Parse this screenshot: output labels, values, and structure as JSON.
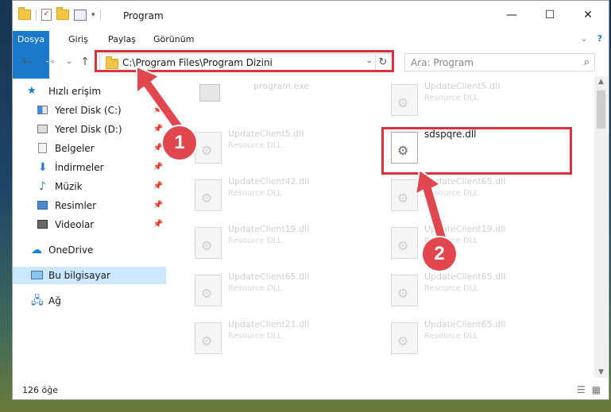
{
  "window": {
    "title": "Program",
    "controls": {
      "minimize": "—",
      "maximize": "☐",
      "close": "✕"
    }
  },
  "ribbon": {
    "tabs": [
      "Dosya",
      "Giriş",
      "Paylaş",
      "Görünüm"
    ],
    "expand": "⌄",
    "help": "?"
  },
  "nav": {
    "back": "←",
    "forward": "→",
    "recent": "⌄",
    "up": "↑"
  },
  "address": {
    "path": "C:\\Program Files\\Program Dizini",
    "dropdown": "⌄",
    "refresh": "↻"
  },
  "search": {
    "placeholder": "Ara: Program",
    "icon": "⌕"
  },
  "sidebar": {
    "items": [
      {
        "label": "Hızlı erişim",
        "icon": "star-icon",
        "pinned": false
      },
      {
        "label": "Yerel Disk (C:)",
        "icon": "drive-icon",
        "pinned": true
      },
      {
        "label": "Yerel Disk (D:)",
        "icon": "drive-icon",
        "pinned": true
      },
      {
        "label": "Belgeler",
        "icon": "document-icon",
        "pinned": true
      },
      {
        "label": "İndirmeler",
        "icon": "download-icon",
        "pinned": true
      },
      {
        "label": "Müzik",
        "icon": "music-icon",
        "pinned": true
      },
      {
        "label": "Resimler",
        "icon": "pictures-icon",
        "pinned": true
      },
      {
        "label": "Videolar",
        "icon": "video-icon",
        "pinned": true
      },
      {
        "label": "OneDrive",
        "icon": "cloud-icon",
        "pinned": false
      },
      {
        "label": "Bu bilgisayar",
        "icon": "computer-icon",
        "pinned": false,
        "selected": true
      },
      {
        "label": "Ağ",
        "icon": "network-icon",
        "pinned": false
      }
    ],
    "pin_glyph": "📌"
  },
  "files": [
    {
      "name": "program.exe",
      "type": ""
    },
    {
      "name": "UpdateClient5.dll",
      "type": "Resource DLL"
    },
    {
      "name": "UpdateClient5.dll",
      "type": "Resource DLL"
    },
    {
      "name": "sdspqre.dll",
      "type": "",
      "featured": true
    },
    {
      "name": "UpdateClient42.dll",
      "type": "Resource DLL"
    },
    {
      "name": "UpdateClient65.dll",
      "type": "Resource DLL"
    },
    {
      "name": "UpdateClient19.dll",
      "type": "Resource DLL"
    },
    {
      "name": "UpdateClient19.dll",
      "type": "Resource DLL"
    },
    {
      "name": "UpdateClient65.dll",
      "type": "Resource DLL"
    },
    {
      "name": "UpdateClient65.dll",
      "type": "Resource DLL"
    },
    {
      "name": "UpdateClient21.dll",
      "type": "Resource DLL"
    },
    {
      "name": "UpdateClient65.dll",
      "type": "Resource DLL"
    }
  ],
  "status": {
    "count": "126 öğe"
  },
  "callouts": [
    "1",
    "2"
  ],
  "colors": {
    "accent": "#1979ca",
    "annotation_red": "#d9323b",
    "selection": "#cce8ff"
  }
}
